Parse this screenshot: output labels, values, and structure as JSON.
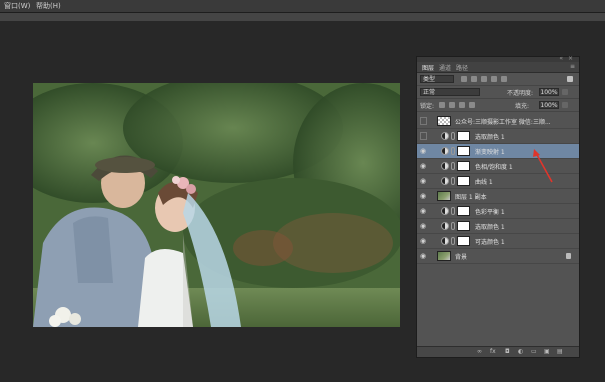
{
  "menu": {
    "items": [
      "窗口(W)",
      "帮助(H)"
    ]
  },
  "layers_panel": {
    "tabs": [
      "图层",
      "通道",
      "路径"
    ],
    "filter_kind": "类型",
    "blend_mode": "正常",
    "opacity_label": "不透明度:",
    "opacity_value": "100%",
    "lock_label": "锁定:",
    "fill_label": "填充:",
    "fill_value": "100%",
    "layers": [
      {
        "name": "公众号:三顺摄影工作室   微信:三顺...",
        "kind": "checker",
        "visible": false
      },
      {
        "name": "选取颜色 1",
        "kind": "adjustment",
        "visible": false
      },
      {
        "name": "渐变映射 1",
        "kind": "adjustment",
        "visible": true,
        "selected": true
      },
      {
        "name": "色相/饱和度 1",
        "kind": "adjustment",
        "visible": true
      },
      {
        "name": "曲线 1",
        "kind": "adjustment",
        "visible": true
      },
      {
        "name": "图层 1 副本",
        "kind": "photo",
        "visible": true
      },
      {
        "name": "色彩平衡 1",
        "kind": "adjustment",
        "visible": true
      },
      {
        "name": "选取颜色 1",
        "kind": "adjustment",
        "visible": true
      },
      {
        "name": "可选颜色 1",
        "kind": "adjustment",
        "visible": true
      },
      {
        "name": "背景",
        "kind": "photo",
        "visible": true,
        "locked": true
      }
    ]
  },
  "colors": {
    "selected_layer": "#6f87a3",
    "panel_bg": "#535353",
    "workspace_bg": "#282828",
    "annotation_arrow": "#e0352b"
  }
}
